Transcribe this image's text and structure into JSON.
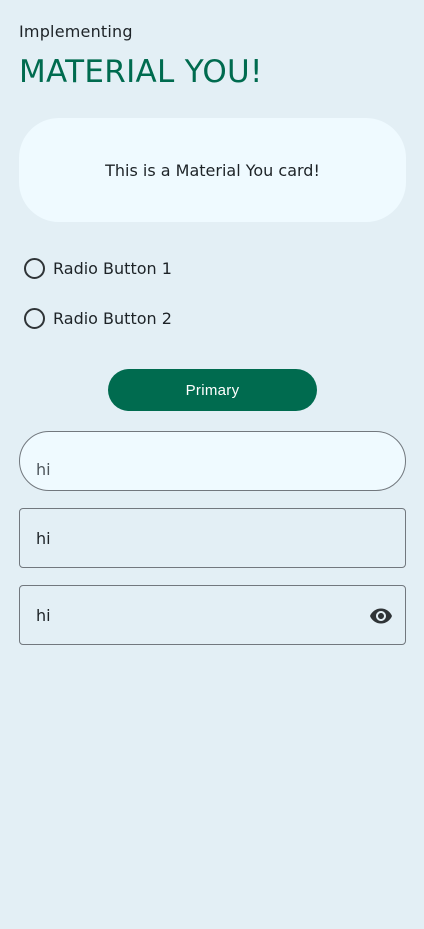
{
  "header": {
    "subtitle": "Implementing",
    "title": "MATERIAL YOU!"
  },
  "card": {
    "text": "This is a Material You card!"
  },
  "radios": [
    {
      "label": "Radio Button 1",
      "selected": false
    },
    {
      "label": "Radio Button 2",
      "selected": false
    }
  ],
  "primary_button": {
    "label": "Primary"
  },
  "fields": {
    "rounded": {
      "value": "hi"
    },
    "outlined": {
      "value": "hi"
    },
    "password": {
      "value": "hi",
      "icon": "eye-icon"
    }
  },
  "colors": {
    "background": "#e3eff5",
    "accent": "#006b4f",
    "card": "#effaff",
    "outline": "#72787e"
  }
}
